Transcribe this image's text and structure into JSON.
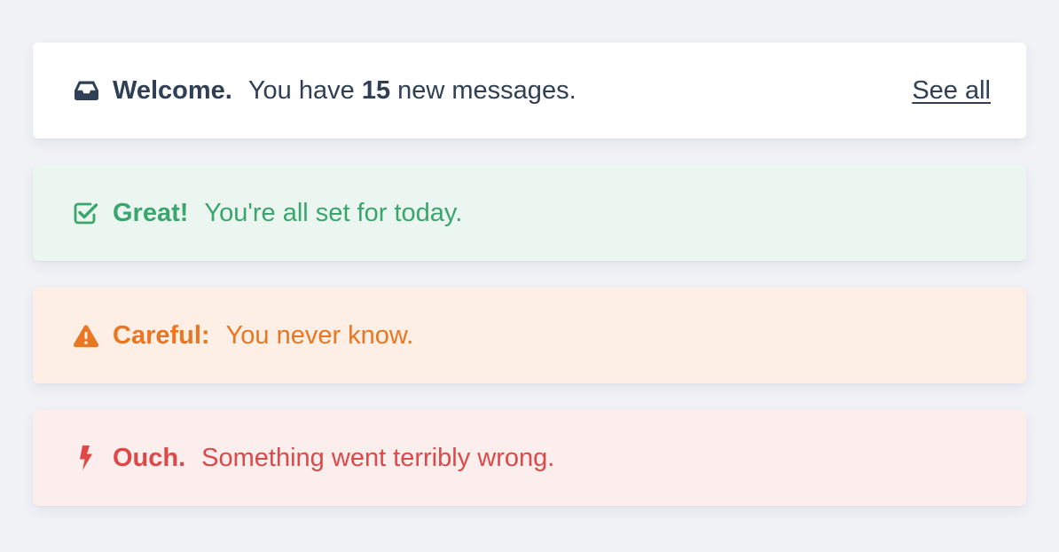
{
  "colors": {
    "background": "#f0f2f6",
    "info_text": "#2f3f55",
    "success_bg": "#ecf6f1",
    "success_text": "#3aa56c",
    "warning_bg": "#fdefe5",
    "warning_text": "#ea7621",
    "error_bg": "#fdeeee",
    "error_text": "#e04848"
  },
  "alerts": {
    "info": {
      "icon": "inbox-icon",
      "title": "Welcome.",
      "message_before": "You have",
      "count": "15",
      "message_after": "new messages.",
      "link": "See all"
    },
    "success": {
      "icon": "checkbox-checked-icon",
      "title": "Great!",
      "message": "You're all set for today."
    },
    "warning": {
      "icon": "warning-triangle-icon",
      "title": "Careful:",
      "message": "You never know."
    },
    "error": {
      "icon": "lightning-bolt-icon",
      "title": "Ouch.",
      "message": "Something went terribly wrong."
    }
  }
}
